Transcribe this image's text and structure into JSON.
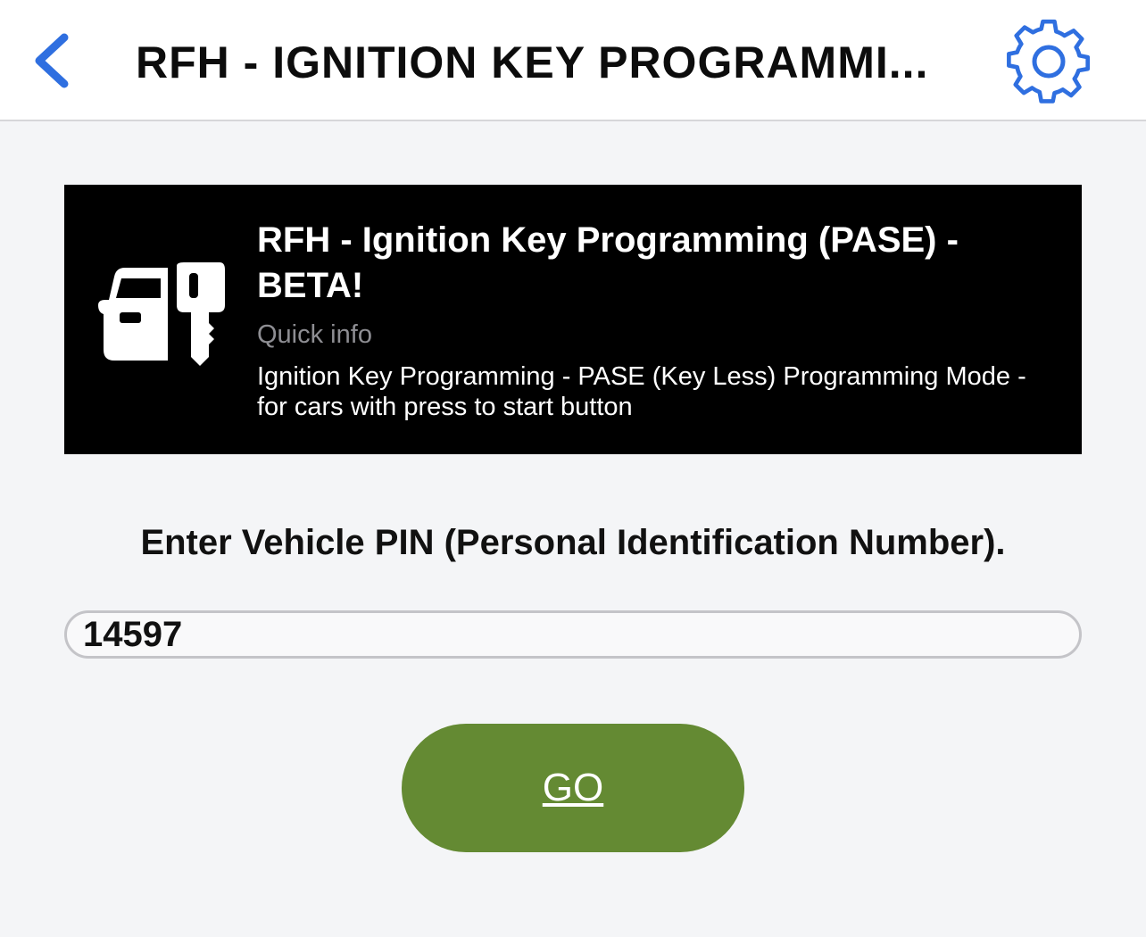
{
  "header": {
    "title": "RFH - IGNITION KEY PROGRAMMI...",
    "back_icon": "chevron-left-icon",
    "settings_icon": "gear-icon",
    "accent_color": "#2f6fe0"
  },
  "card": {
    "icon": "car-key-icon",
    "title": "RFH - Ignition Key Programming (PASE) - BETA!",
    "subtitle": "Quick info",
    "description": "Ignition Key Programming - PASE (Key Less) Programming Mode - for cars with press to start button"
  },
  "form": {
    "prompt": "Enter Vehicle PIN (Personal Identification Number).",
    "pin_value": "14597"
  },
  "actions": {
    "go_label": "GO",
    "go_color": "#648a33"
  }
}
